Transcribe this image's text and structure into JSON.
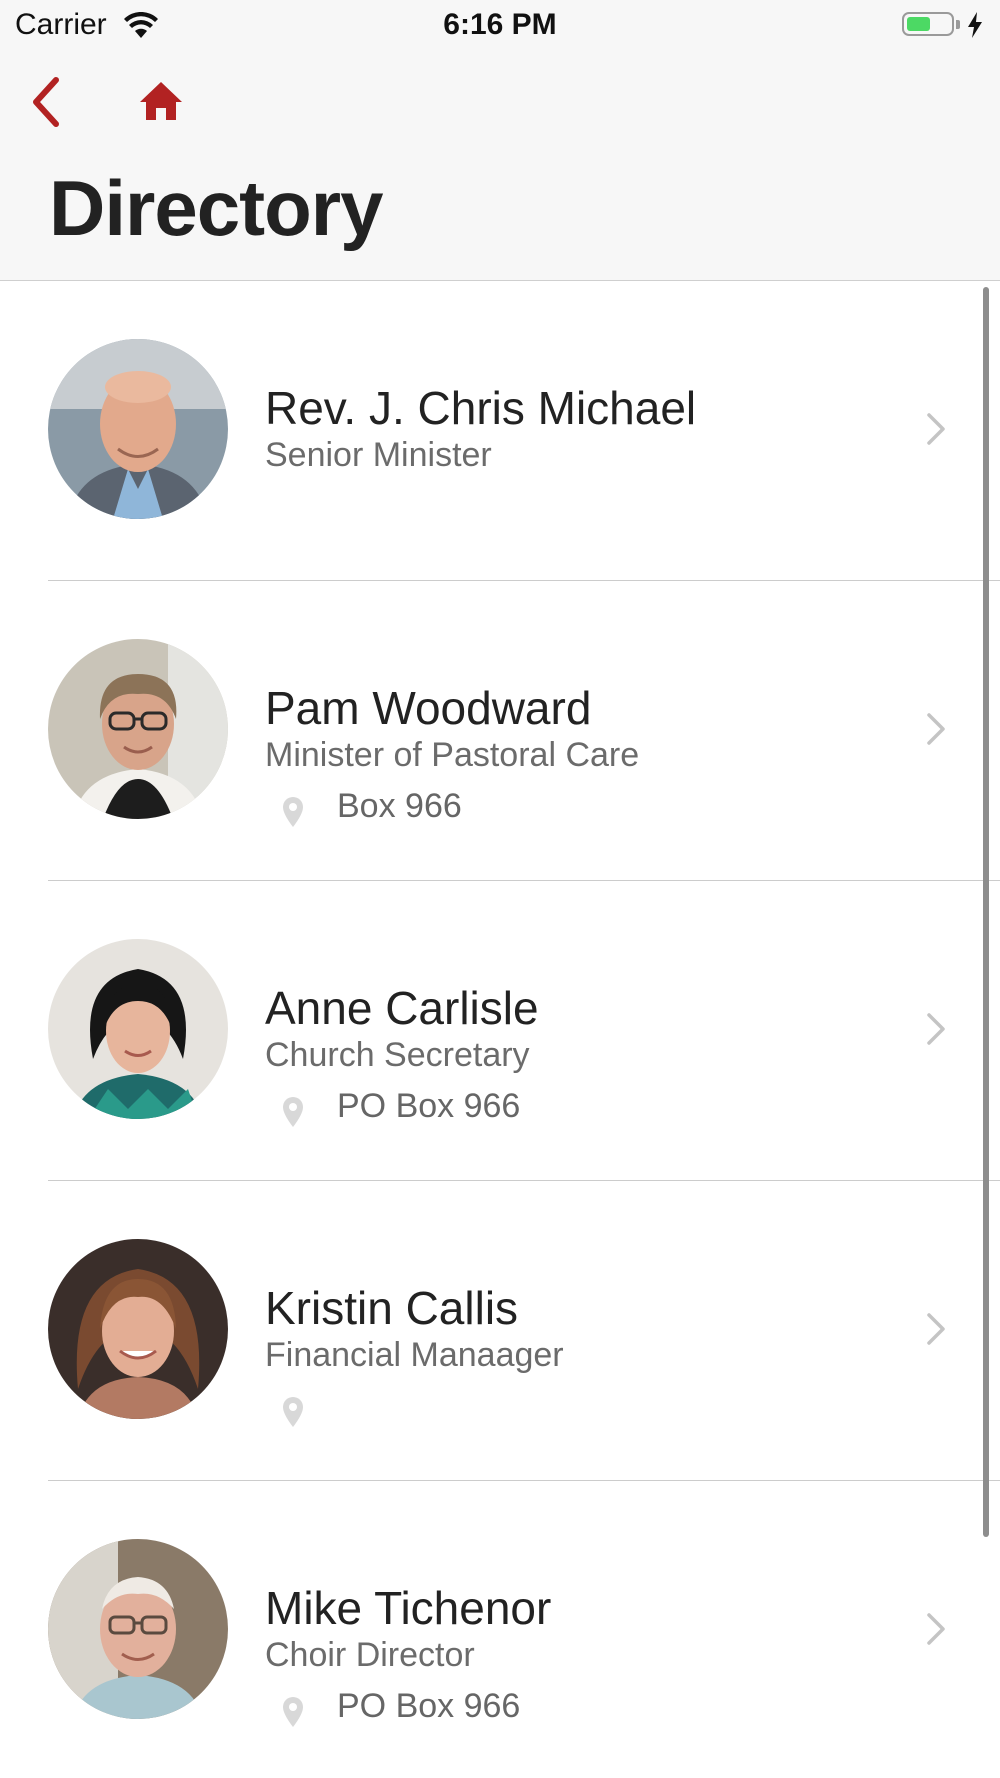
{
  "status_bar": {
    "carrier": "Carrier",
    "time": "6:16 PM",
    "battery_level": 0.55
  },
  "nav": {
    "back_icon": "chevron-left-icon",
    "home_icon": "home-icon",
    "accent_color": "#b22222"
  },
  "page_title": "Directory",
  "directory": [
    {
      "name": "Rev. J. Chris Michael",
      "role": "Senior Minister",
      "address": null,
      "show_pin": false
    },
    {
      "name": "Pam Woodward",
      "role": "Minister of Pastoral Care",
      "address": "Box 966",
      "show_pin": true
    },
    {
      "name": "Anne Carlisle",
      "role": "Church Secretary",
      "address": "PO Box 966",
      "show_pin": true
    },
    {
      "name": "Kristin Callis",
      "role": "Financial Manaager",
      "address": "",
      "show_pin": true
    },
    {
      "name": "Mike Tichenor",
      "role": "Choir Director",
      "address": "PO Box 966",
      "show_pin": true
    }
  ]
}
